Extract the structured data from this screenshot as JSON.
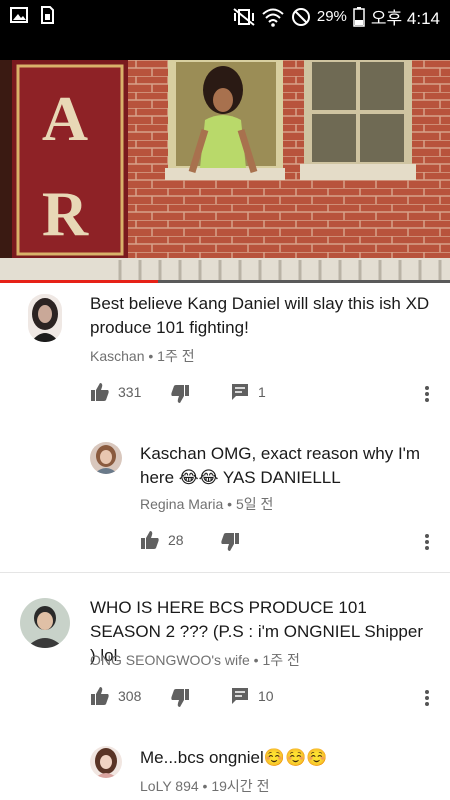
{
  "status_bar": {
    "battery_percent": "29%",
    "time": "오후 4:14",
    "left_icons": [
      "gallery-icon",
      "sim-icon"
    ],
    "right_icons": [
      "mute-vibrate-icon",
      "wifi-icon",
      "no-disturb-icon",
      "battery-icon"
    ]
  },
  "video": {
    "progress_fraction": 0.35,
    "sign_letters": [
      "A",
      "R"
    ]
  },
  "comments": [
    {
      "text": "Best believe Kang Daniel will slay this ish XD produce 101 fighting!",
      "author": "Kaschan",
      "time": "1주 전",
      "likes": "331",
      "replies": "1",
      "is_reply": false
    },
    {
      "text": "Kaschan OMG, exact reason why I'm here 😂😂 YAS DANIELLL",
      "author": "Regina Maria",
      "time": "5일 전",
      "likes": "28",
      "is_reply": true
    },
    {
      "text": "WHO IS HERE BCS PRODUCE 101 SEASON 2 ??? (P.S : i'm ONGNIEL Shipper ) lol",
      "author": "ONG SEONGWOO's wife",
      "time": "1주 전",
      "likes": "308",
      "replies": "10",
      "is_reply": false
    },
    {
      "text": "Me...bcs ongniel☺️☺️☺️",
      "author": "LoLY 894",
      "time": "19시간 전",
      "is_reply": true
    }
  ],
  "separator": " • ",
  "colors": {
    "progress": "#e62117",
    "meta": "#707070",
    "icon": "#606060"
  }
}
